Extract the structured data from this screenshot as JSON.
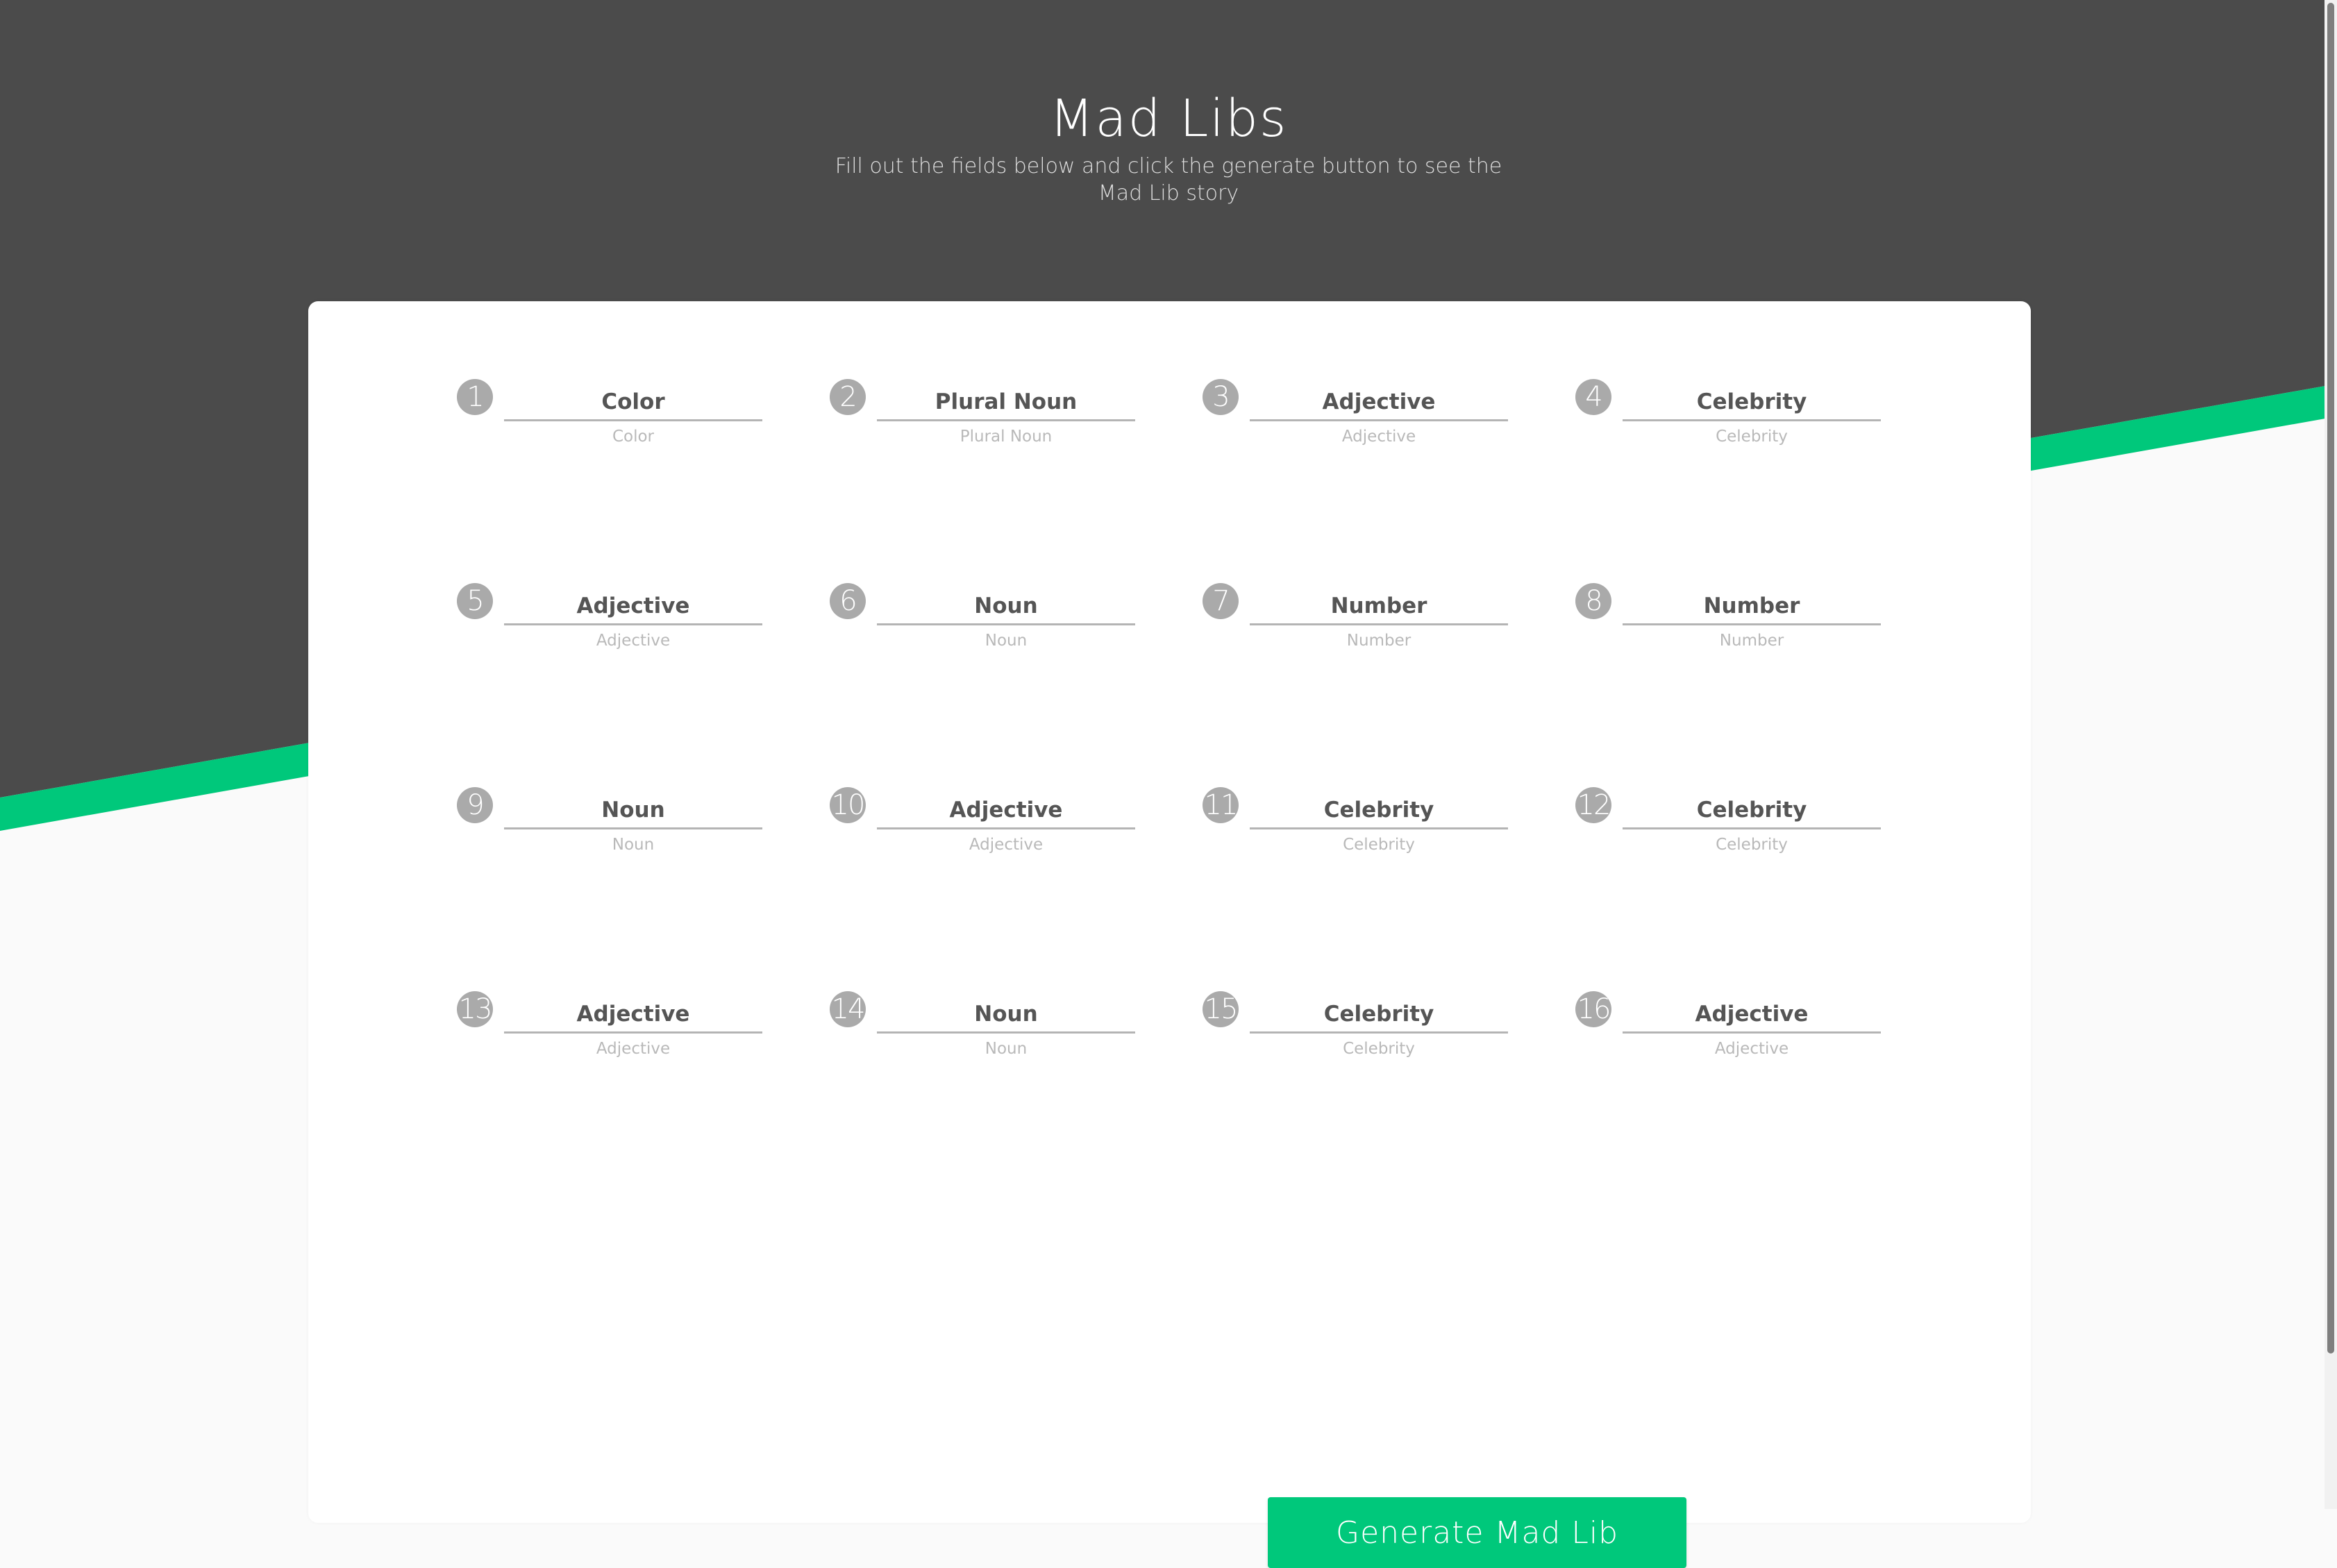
{
  "header": {
    "title": "Mad Libs",
    "subtitle": "Fill out the fields below and click the generate button to see the Mad Lib story"
  },
  "fields": [
    {
      "number": "1",
      "label": "Color",
      "hint": "Color"
    },
    {
      "number": "2",
      "label": "Plural Noun",
      "hint": "Plural Noun"
    },
    {
      "number": "3",
      "label": "Adjective",
      "hint": "Adjective"
    },
    {
      "number": "4",
      "label": "Celebrity",
      "hint": "Celebrity"
    },
    {
      "number": "5",
      "label": "Adjective",
      "hint": "Adjective"
    },
    {
      "number": "6",
      "label": "Noun",
      "hint": "Noun"
    },
    {
      "number": "7",
      "label": "Number",
      "hint": "Number"
    },
    {
      "number": "8",
      "label": "Number",
      "hint": "Number"
    },
    {
      "number": "9",
      "label": "Noun",
      "hint": "Noun"
    },
    {
      "number": "10",
      "label": "Adjective",
      "hint": "Adjective"
    },
    {
      "number": "11",
      "label": "Celebrity",
      "hint": "Celebrity"
    },
    {
      "number": "12",
      "label": "Celebrity",
      "hint": "Celebrity"
    },
    {
      "number": "13",
      "label": "Adjective",
      "hint": "Adjective"
    },
    {
      "number": "14",
      "label": "Noun",
      "hint": "Noun"
    },
    {
      "number": "15",
      "label": "Celebrity",
      "hint": "Celebrity"
    },
    {
      "number": "16",
      "label": "Adjective",
      "hint": "Adjective"
    }
  ],
  "button": {
    "label": "Generate Mad Lib"
  },
  "colors": {
    "header_bg": "#4b4b4b",
    "accent": "#00c87b",
    "page_bg": "#fafafa",
    "badge": "#aaaaaa"
  }
}
